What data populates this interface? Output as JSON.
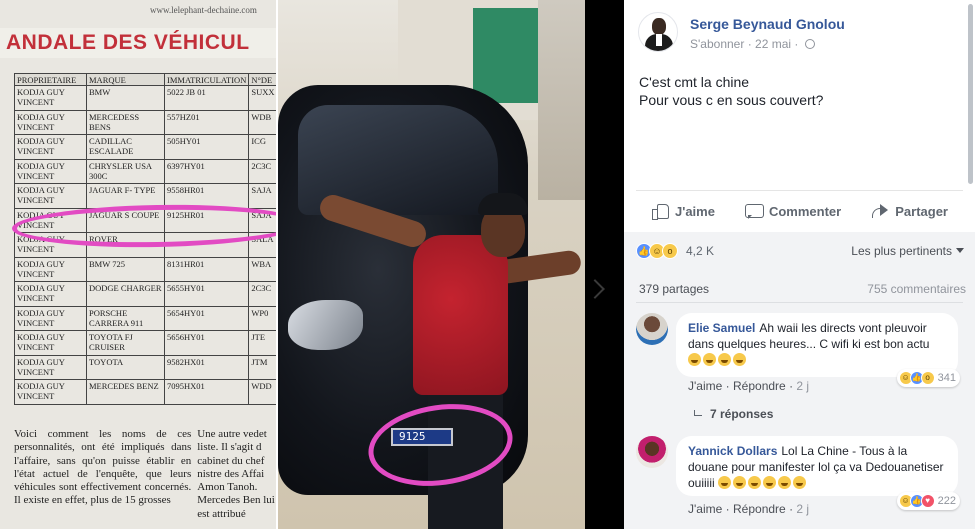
{
  "photo": {
    "newspaper": {
      "url": "www.lelephant-dechaine.com",
      "headline": "ANDALE DES VÉHICUL",
      "table_headers": [
        "PROPRIETAIRE",
        "MARQUE",
        "IMMATRICULATION",
        "N°DE"
      ],
      "rows": [
        [
          "KODJA GUY VINCENT",
          "BMW",
          "5022 JB 01",
          "SUXX"
        ],
        [
          "KODJA GUY VINCENT",
          "MERCEDESS BENS",
          "557HZ01",
          "WDB"
        ],
        [
          "KODJA GUY VINCENT",
          "CADILLAC ESCALADE",
          "505HY01",
          "ICG"
        ],
        [
          "KODJA GUY VINCENT",
          "CHRYSLER USA 300C",
          "6397HY01",
          "2C3C"
        ],
        [
          "KODJA GUY VINCENT",
          "JAGUAR F- TYPE",
          "9558HR01",
          "SAJA"
        ],
        [
          "KODJA GUY VINCENT",
          "JAGUAR S COUPE",
          "9125HR01",
          "SAJA"
        ],
        [
          "KODJA GUY VINCENT",
          "ROVER",
          "",
          "SALA"
        ],
        [
          "KODJA GUY VINCENT",
          "BMW 725",
          "8131HR01",
          "WBA"
        ],
        [
          "KODJA GUY VINCENT",
          "DODGE CHARGER",
          "5655HY01",
          "2C3C"
        ],
        [
          "KODJA GUY VINCENT",
          "PORSCHE CARRERA 911",
          "5654HY01",
          "WP0"
        ],
        [
          "KODJA GUY VINCENT",
          "TOYOTA FJ CRUISER",
          "5656HY01",
          "JTE"
        ],
        [
          "KODJA GUY VINCENT",
          "TOYOTA",
          "9582HX01",
          "JTM"
        ],
        [
          "KODJA GUY VINCENT",
          "MERCEDES BENZ",
          "7095HX01",
          "WDD"
        ]
      ],
      "body_col_a": "Voici comment les noms de ces personnalités, ont été impliqués dans l'affaire, sans qu'on puisse établir en l'état actuel de l'enquête, que leurs véhicules sont effectivement concernés. Il existe en effet, plus de 15 grosses",
      "body_col_b": "Une autre vedet liste. Il s'agit d cabinet du chef nistre des Affai Amon Tanoh. Mercedes Ben lui est attribué"
    },
    "plate_text": "9125"
  },
  "post": {
    "author_name": "Serge Beynaud Gnolou",
    "follow_label": "S'abonner",
    "dot": "·",
    "date": "22 mai",
    "dot2": "·",
    "text_lines": [
      "C'est cmt la chine",
      "Pour vous c en sous couvert?"
    ],
    "actions": {
      "like": "J'aime",
      "comment": "Commenter",
      "share": "Partager"
    },
    "reaction_count": "4,2 K",
    "sort_label": "Les plus pertinents",
    "shares": "379 partages",
    "comments_count": "755 commentaires"
  },
  "comments": [
    {
      "name": "Elie Samuel",
      "text": "Ah waii les directs vont pleuvoir dans quelques heures... C wifi ki est bon actu",
      "emoji_count": 4,
      "reaction_count": "341",
      "like_label": "J'aime",
      "reply_label": "Répondre",
      "dot": "·",
      "time": "2 j",
      "replies": "7 réponses"
    },
    {
      "name": "Yannick Dollars",
      "text": "Lol La Chine - Tous à la douane pour manifester lol ça va Dedouanetiser ouiiiii",
      "emoji_count": 6,
      "reaction_count": "222",
      "like_label": "J'aime",
      "reply_label": "Répondre",
      "dot": "·",
      "time": "2 j"
    }
  ],
  "icons": {
    "like": "thumb-icon",
    "comment": "comment-icon",
    "share": "share-icon",
    "privacy": "globe-icon",
    "reactions": [
      "like-reaction-icon",
      "haha-reaction-icon",
      "wow-reaction-icon",
      "love-reaction-icon"
    ]
  },
  "colors": {
    "link_blue": "#365899",
    "headline_red": "#c2303a",
    "marker_pink": "#e24bc3",
    "like_blue": "#5890ff",
    "emoji_yellow": "#f7c94b",
    "love_red": "#f25268",
    "comments_bg": "#f2f3f5"
  }
}
